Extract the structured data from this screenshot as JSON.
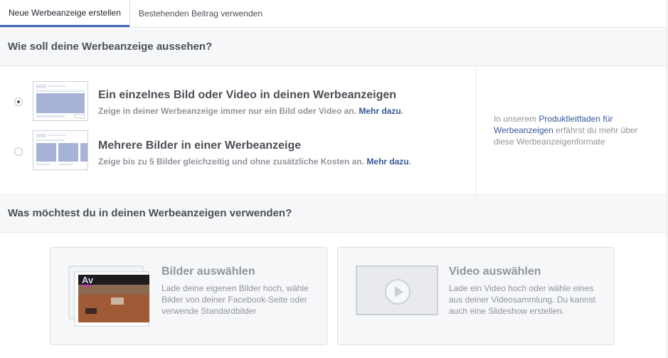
{
  "tabs": [
    {
      "label": "Neue Werbeanzeige erstellen",
      "active": true
    },
    {
      "label": "Bestehenden Beitrag verwenden",
      "active": false
    }
  ],
  "format_section": {
    "heading": "Wie soll deine Werbeanzeige aussehen?",
    "options": [
      {
        "title": "Ein einzelnes Bild oder Video in deinen Werbeanzeigen",
        "description": "Zeige in deiner Werbeanzeige immer nur ein Bild oder Video an.",
        "link": "Mehr dazu",
        "selected": true
      },
      {
        "title": "Mehrere Bilder in einer Werbeanzeige",
        "description": "Zeige bis zu 5 Bilder gleichzeitig und ohne zusätzliche Kosten an.",
        "link": "Mehr dazu",
        "selected": false
      }
    ],
    "sidebar": {
      "prefix": "In unserem ",
      "link": "Produktleitfaden für Werbeanzeigen",
      "suffix": " erfährst du mehr über diese Werbeanzeigenformate"
    }
  },
  "media_section": {
    "heading": "Was möchtest du in deinen Werbeanzeigen verwenden?",
    "cards": [
      {
        "title": "Bilder auswählen",
        "description": "Lade deine eigenen Bilder hoch, wähle Bilder von deiner Facebook-Seite oder verwende Standardbilder",
        "icon": "image-stack-icon"
      },
      {
        "title": "Video auswählen",
        "description": "Lade ein Video hoch oder wähle eines aus deiner Videosammlung. Du kannst auch eine Slideshow erstellen.",
        "icon": "play-icon"
      }
    ]
  },
  "colors": {
    "accent": "#4267b2",
    "link": "#365899",
    "muted": "#90949c",
    "text": "#4b4f56"
  }
}
